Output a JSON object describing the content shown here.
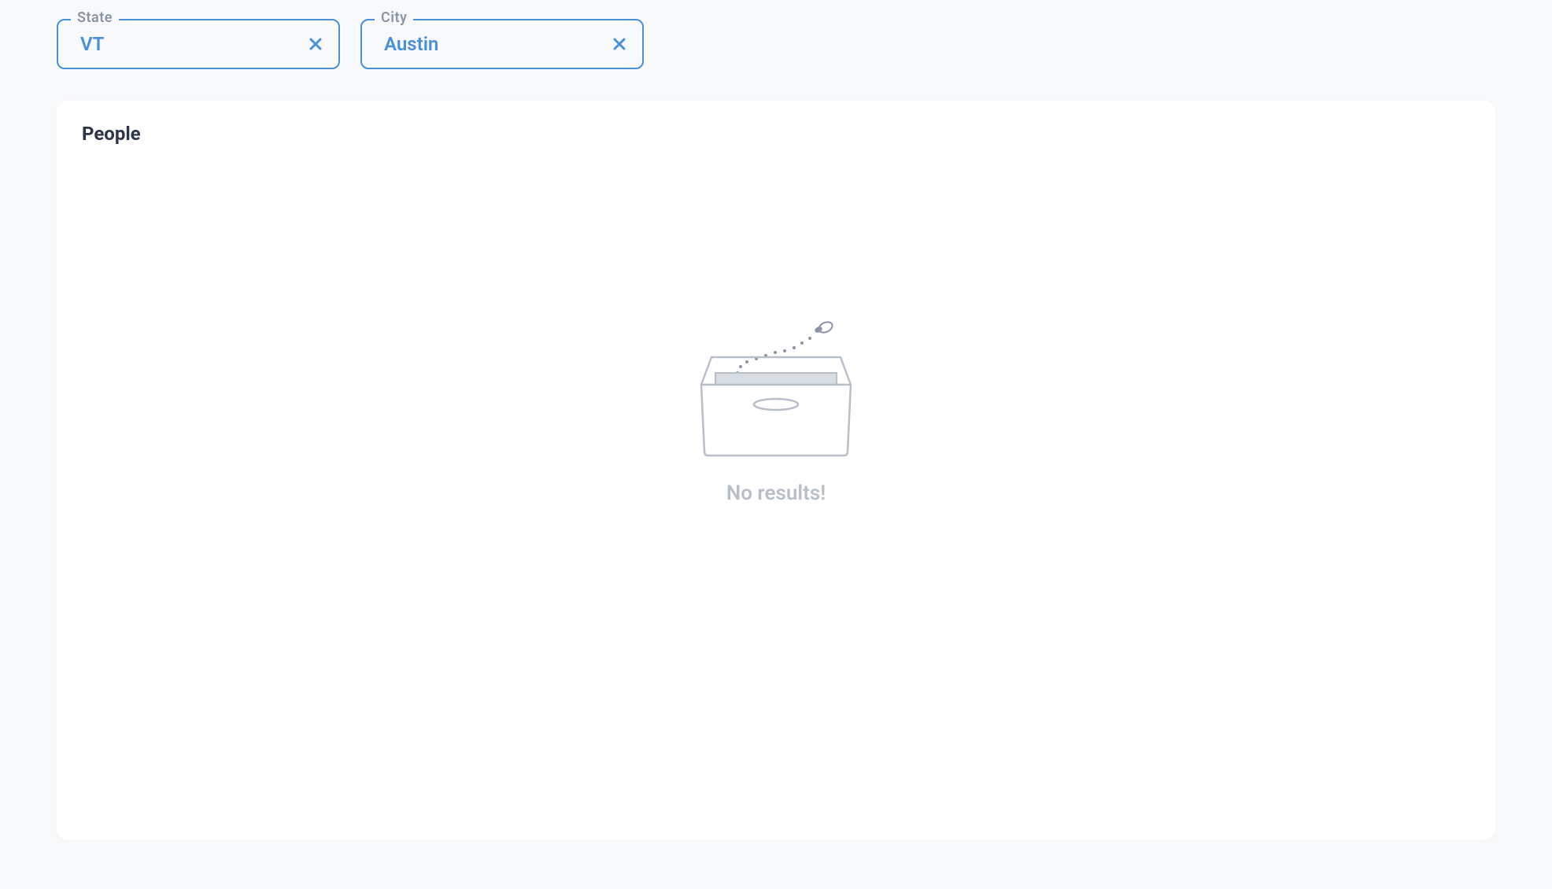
{
  "filters": {
    "state": {
      "label": "State",
      "value": "VT"
    },
    "city": {
      "label": "City",
      "value": "Austin"
    }
  },
  "panel": {
    "title": "People"
  },
  "empty_state": {
    "message": "No results!"
  }
}
